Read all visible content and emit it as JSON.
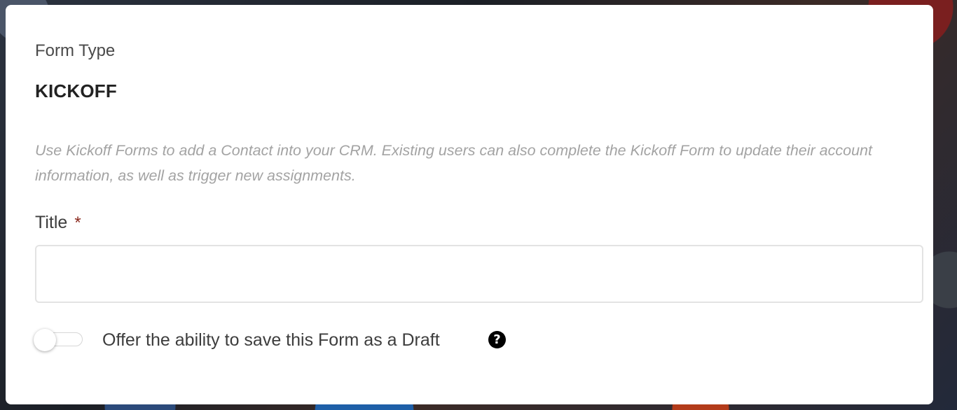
{
  "form": {
    "form_type_label": "Form Type",
    "form_type_value": "KICKOFF",
    "description": "Use Kickoff Forms to add a Contact into your CRM. Existing users can also complete the Kickoff Form to update their account information, as well as trigger new assignments.",
    "title_label": "Title",
    "required_marker": "*",
    "title_value": "",
    "title_placeholder": "",
    "draft_toggle_label": "Offer the ability to save this Form as a Draft",
    "draft_toggle_on": false,
    "help_icon_glyph": "?",
    "help_icon": "question-circle-icon"
  },
  "colors": {
    "required_marker": "#8b2a1e",
    "description_text": "#a3a3a3",
    "card_background": "#ffffff"
  }
}
